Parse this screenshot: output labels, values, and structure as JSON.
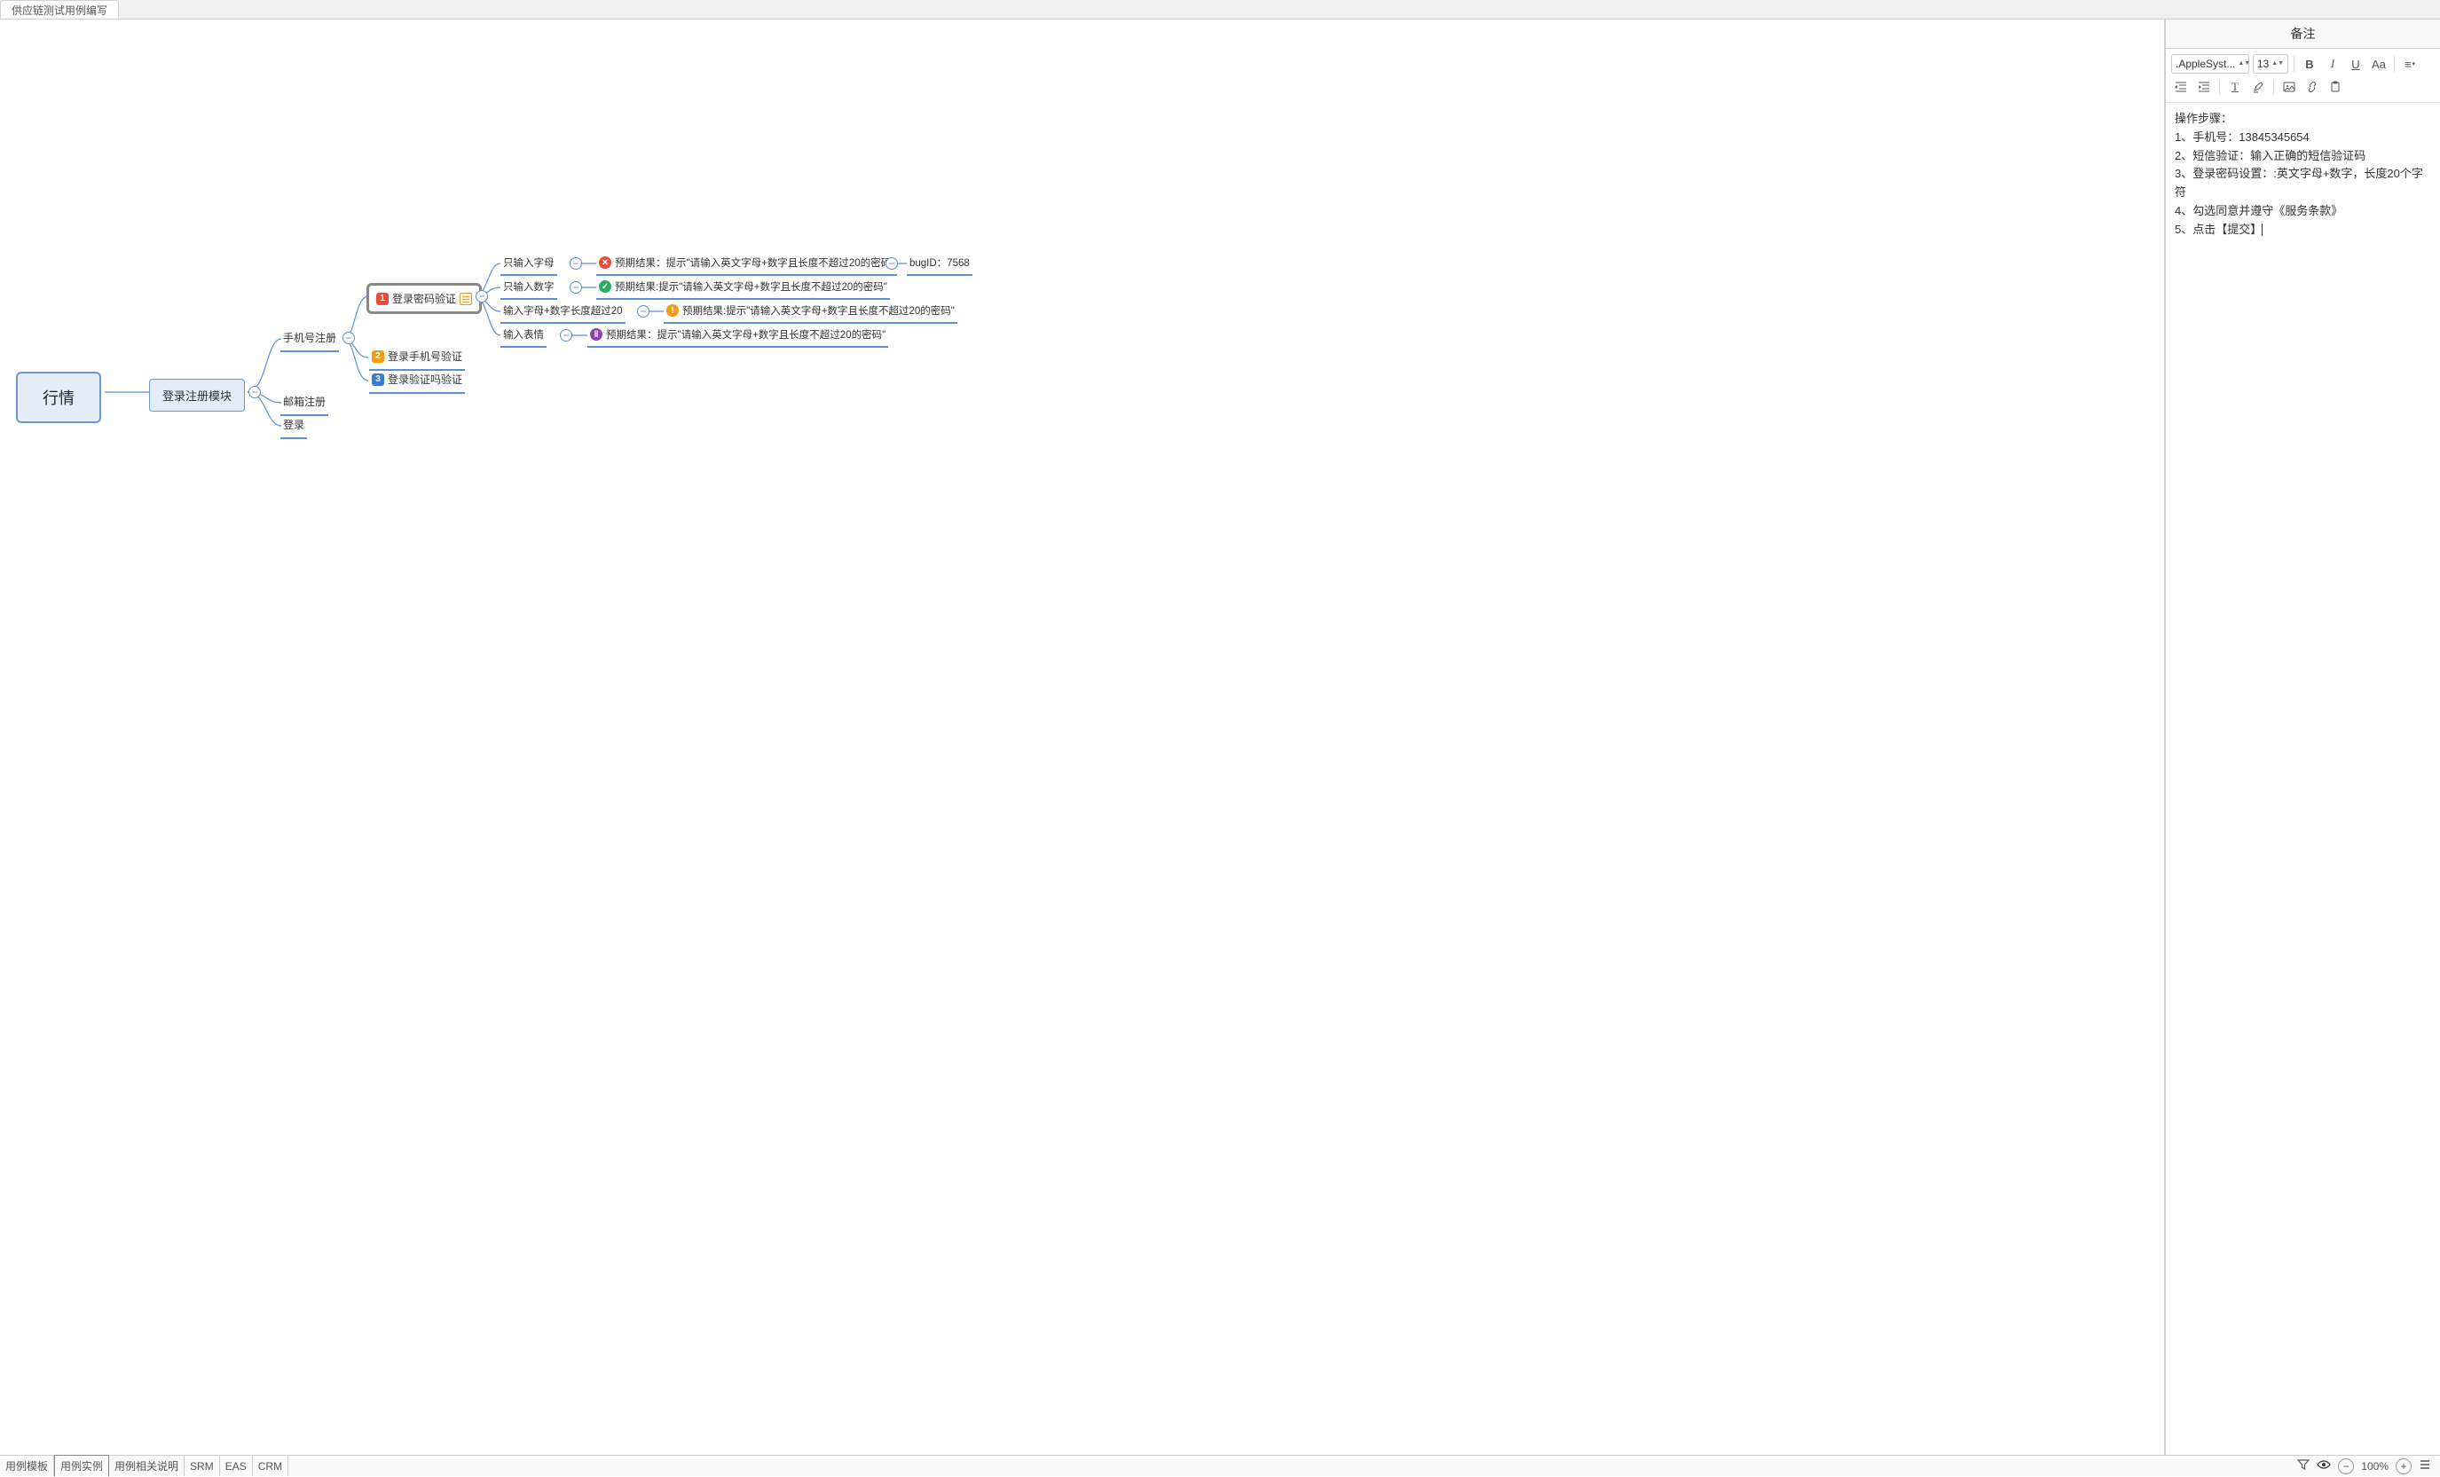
{
  "top_tab": "供应链测试用例编写",
  "notes_panel": {
    "header": "备注",
    "font_family": ".AppleSyst...",
    "font_size": "13",
    "content_lines": [
      "操作步骤：",
      "1、手机号：13845345654",
      "2、短信验证：输入正确的短信验证码",
      "3、登录密码设置：:英文字母+数字，长度20个字符",
      "4、勾选同意并遵守《服务条款》",
      "5、点击【提交】"
    ]
  },
  "bottom_tabs": [
    "用例模板",
    "用例实例",
    "用例相关说明",
    "SRM",
    "EAS",
    "CRM"
  ],
  "bottom_active_index": 1,
  "zoom": "100%",
  "mindmap": {
    "root": "行情",
    "sub": "登录注册模块",
    "branches": [
      "手机号注册",
      "邮箱注册",
      "登录"
    ],
    "phone_children": [
      {
        "num": "1",
        "label": "登录密码验证",
        "has_note": true,
        "selected": true
      },
      {
        "num": "2",
        "label": "登录手机号验证"
      },
      {
        "num": "3",
        "label": "登录验证吗验证"
      }
    ],
    "pwd_cases": [
      {
        "case": "只输入字母",
        "status": "fail",
        "result": "预期结果：提示\"请输入英文字母+数字且长度不超过20的密码\"",
        "extra_label": "bugID：7568"
      },
      {
        "case": "只输入数字",
        "status": "pass",
        "result": "预期结果:提示\"请输入英文字母+数字且长度不超过20的密码\""
      },
      {
        "case": "输入字母+数字长度超过20",
        "status": "warn",
        "result": "预期结果:提示\"请输入英文字母+数字且长度不超过20的密码\""
      },
      {
        "case": "输入表情",
        "status": "block",
        "result": "预期结果：提示\"请输入英文字母+数字且长度不超过20的密码\""
      }
    ]
  },
  "icons": {
    "bold": "B",
    "italic": "I",
    "underline": "U",
    "textcase": "Aa"
  }
}
